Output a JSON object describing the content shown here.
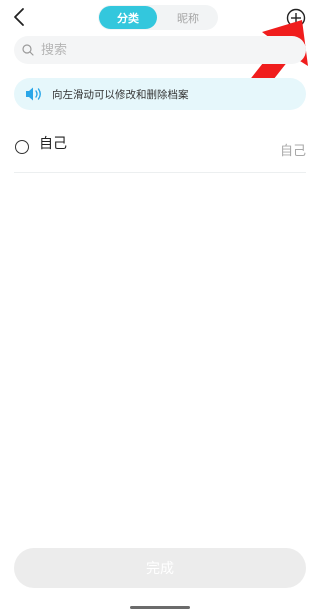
{
  "header": {
    "tabs": [
      {
        "label": "分类",
        "active": true
      },
      {
        "label": "昵称",
        "active": false
      }
    ],
    "back_icon": "chevron-left-icon",
    "add_icon": "plus-circle-icon"
  },
  "search": {
    "placeholder": "搜索",
    "value": ""
  },
  "tip": {
    "icon": "speaker-icon",
    "text": "向左滑动可以修改和删除档案"
  },
  "list": {
    "items": [
      {
        "name": "自己",
        "value": "自己",
        "selected": false
      }
    ]
  },
  "footer": {
    "done_label": "完成"
  },
  "colors": {
    "accent": "#33c7dd",
    "tip_bg": "#e6f7fb",
    "tip_icon": "#2aa6e8",
    "annotation": "#f01d1d",
    "disabled_button": "#ececec"
  }
}
